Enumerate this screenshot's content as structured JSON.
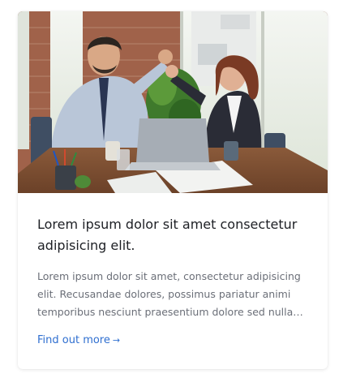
{
  "card": {
    "title": "Lorem ipsum dolor sit amet consectetur adipisicing elit.",
    "text": "Lorem ipsum dolor sit amet, consectetur adipisicing elit. Recusandae dolores, possimus pariatur animi temporibus nesciunt praesentium dolore sed nulla…",
    "link_label": "Find out more",
    "link_arrow": "→",
    "image_icon": "office-high-five-photo"
  },
  "colors": {
    "title": "#1d1f24",
    "text": "#6b6f78",
    "link": "#2f6fd0"
  }
}
